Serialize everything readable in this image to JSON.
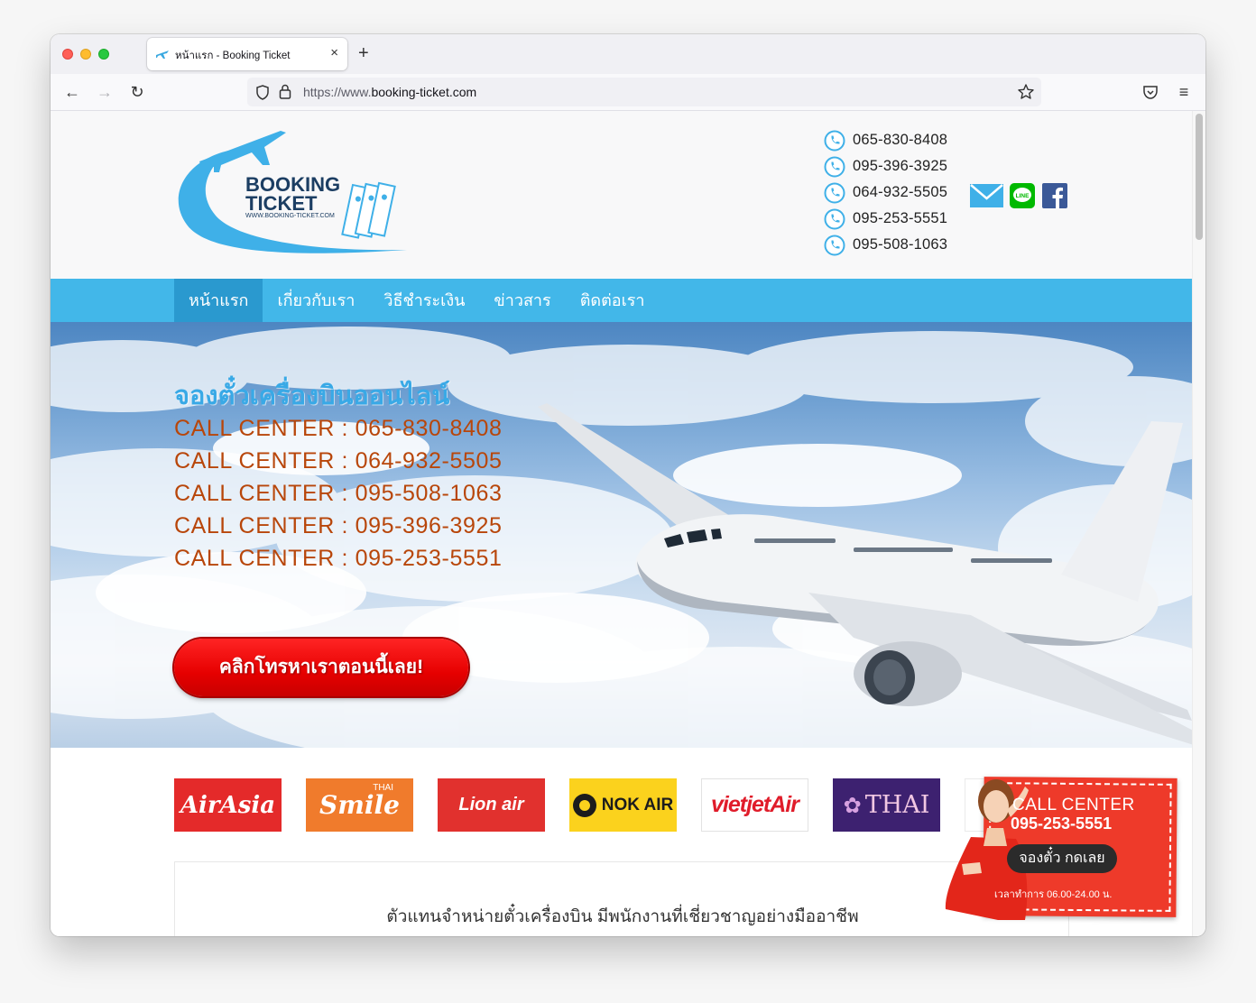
{
  "browser": {
    "tab_title": "หน้าแรก - Booking Ticket",
    "tab_close": "×",
    "new_tab": "+",
    "url_prefix": "https://www.",
    "url_host": "booking-ticket.com",
    "back": "←",
    "forward": "→",
    "reload": "↻",
    "menu": "≡"
  },
  "header": {
    "logo_text_line1": "BOOKING",
    "logo_text_line2": "TICKET",
    "logo_subtext": "WWW.BOOKING-TICKET.COM",
    "phones": [
      "065-830-8408",
      "095-396-3925",
      "064-932-5505",
      "095-253-5551",
      "095-508-1063"
    ],
    "social_icons": [
      "email-icon",
      "line-icon",
      "facebook-icon"
    ]
  },
  "menu": {
    "items": [
      {
        "label": "หน้าแรก",
        "active": true
      },
      {
        "label": "เกี่ยวกับเรา",
        "active": false
      },
      {
        "label": "วิธีชำระเงิน",
        "active": false
      },
      {
        "label": "ข่าวสาร",
        "active": false
      },
      {
        "label": "ติดต่อเรา",
        "active": false
      }
    ]
  },
  "hero": {
    "title": "จองตั๋วเครื่องบินออนไลน์",
    "call_lines": [
      "CALL CENTER : 065-830-8408",
      "CALL CENTER : 064-932-5505",
      "CALL CENTER : 095-508-1063",
      "CALL CENTER : 095-396-3925",
      "CALL CENTER : 095-253-5551"
    ],
    "cta_label": "คลิกโทรหาเราตอนนี้เลย!"
  },
  "airlines": {
    "airasia": "AirAsia",
    "smile_thai": "THAI",
    "smile": "Smile",
    "lion": "Lion air",
    "nok": "NOK AIR",
    "vietjet": "vietjetAir",
    "thai": "THAI"
  },
  "content": {
    "heading": "ตัวแทนจำหน่ายตั๋วเครื่องบิน มีพนักงานที่เชี่ยวชาญอย่างมืออาชีพ"
  },
  "float_badge": {
    "title": "CALL CENTER",
    "phone": "095-253-5551",
    "button": "จองตั๋ว กดเลย",
    "hours": "เวลาทำการ 06.00-24.00 น."
  },
  "colors": {
    "brand_blue": "#42b7e9",
    "menu_active": "#2a99cf",
    "call_text": "#b8460a",
    "cta_red": "#e60000"
  }
}
